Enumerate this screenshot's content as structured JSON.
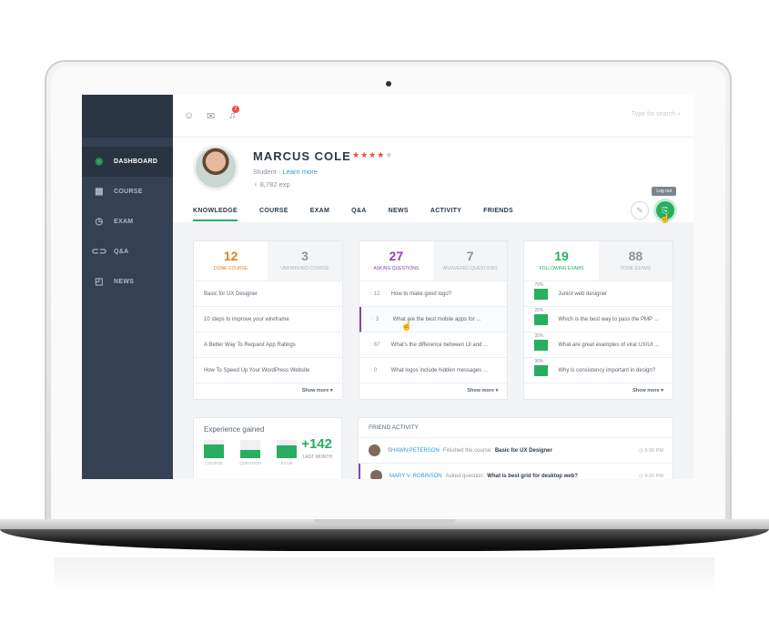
{
  "topbar": {
    "notif_count": "2",
    "search_placeholder": "Type for search"
  },
  "sidebar": {
    "items": [
      {
        "label": "DASHBOARD",
        "icon": "dashboard-icon"
      },
      {
        "label": "COURSE",
        "icon": "course-icon"
      },
      {
        "label": "EXAM",
        "icon": "clock-icon"
      },
      {
        "label": "Q&A",
        "icon": "qa-icon"
      },
      {
        "label": "NEWS",
        "icon": "rss-icon"
      }
    ]
  },
  "profile": {
    "name": "MARCUS COLE",
    "rating": 4,
    "role": "Student",
    "separator": "·",
    "learn_more": "Learn more",
    "exp": "8,782 exp",
    "tooltip": "Log out"
  },
  "tabs": [
    "KNOWLEDGE",
    "COURSE",
    "EXAM",
    "Q&A",
    "NEWS",
    "ACTIVITY",
    "FRIENDS"
  ],
  "knowledge": {
    "done": {
      "num": "12",
      "label": "DONE COURSE"
    },
    "unfinished": {
      "num": "3",
      "label": "UNFINISHED COURSE"
    },
    "items": [
      "Basic for UX Designer",
      "10 steps to improve your wireframe",
      "A Better Way To Request App Ratings",
      "How To Speed Up Your WordPress Website"
    ],
    "more": "Show more"
  },
  "qa": {
    "asking": {
      "num": "27",
      "label": "ASKING QUESTIONS"
    },
    "answered": {
      "num": "7",
      "label": "ANSWERED QUESTIONS"
    },
    "items": [
      {
        "count": "12",
        "text": "How to make good logo?"
      },
      {
        "count": "3",
        "text": "What are the best mobile apps for ..."
      },
      {
        "count": "67",
        "text": "What's the difference between UI and ..."
      },
      {
        "count": "0",
        "text": "What logos include hidden messages ..."
      }
    ],
    "more": "Show more"
  },
  "exams": {
    "following": {
      "num": "19",
      "label": "FOLLOWING EXAMS"
    },
    "done": {
      "num": "88",
      "label": "DONE EXAMS"
    },
    "items": [
      {
        "pct": "70%",
        "text": "Junior web designer"
      },
      {
        "pct": "20%",
        "text": "Which is the best way to pass the PMP ..."
      },
      {
        "pct": "35%",
        "text": "What are great examples of viral UX/UI ..."
      },
      {
        "pct": "90%",
        "text": "Why is consistency important in design?"
      }
    ],
    "more": "Show more"
  },
  "experience": {
    "title": "Experience gained",
    "bars": [
      {
        "label": "COURSE",
        "level": 0.75
      },
      {
        "label": "QUESTION",
        "level": 0.45
      },
      {
        "label": "EXAM",
        "level": 0.7
      }
    ],
    "value": "+142",
    "period": "LAST MONTH"
  },
  "friend_activity": {
    "title": "FRIEND ACTIVITY",
    "items": [
      {
        "name": "SHAWN PETERSON",
        "action": "Finished the course:",
        "target": "Basic for UX Designer",
        "time": "9:30 PM"
      },
      {
        "name": "MARY V. ROBINSON",
        "action": "Asked question:",
        "target": "What is best grid for desktop web?",
        "time": "9:20 PM"
      }
    ]
  },
  "colors": {
    "sidebar": "#334152",
    "green": "#27ae60",
    "orange": "#e67e22",
    "purple": "#8e44ad",
    "red": "#e74c3c"
  }
}
